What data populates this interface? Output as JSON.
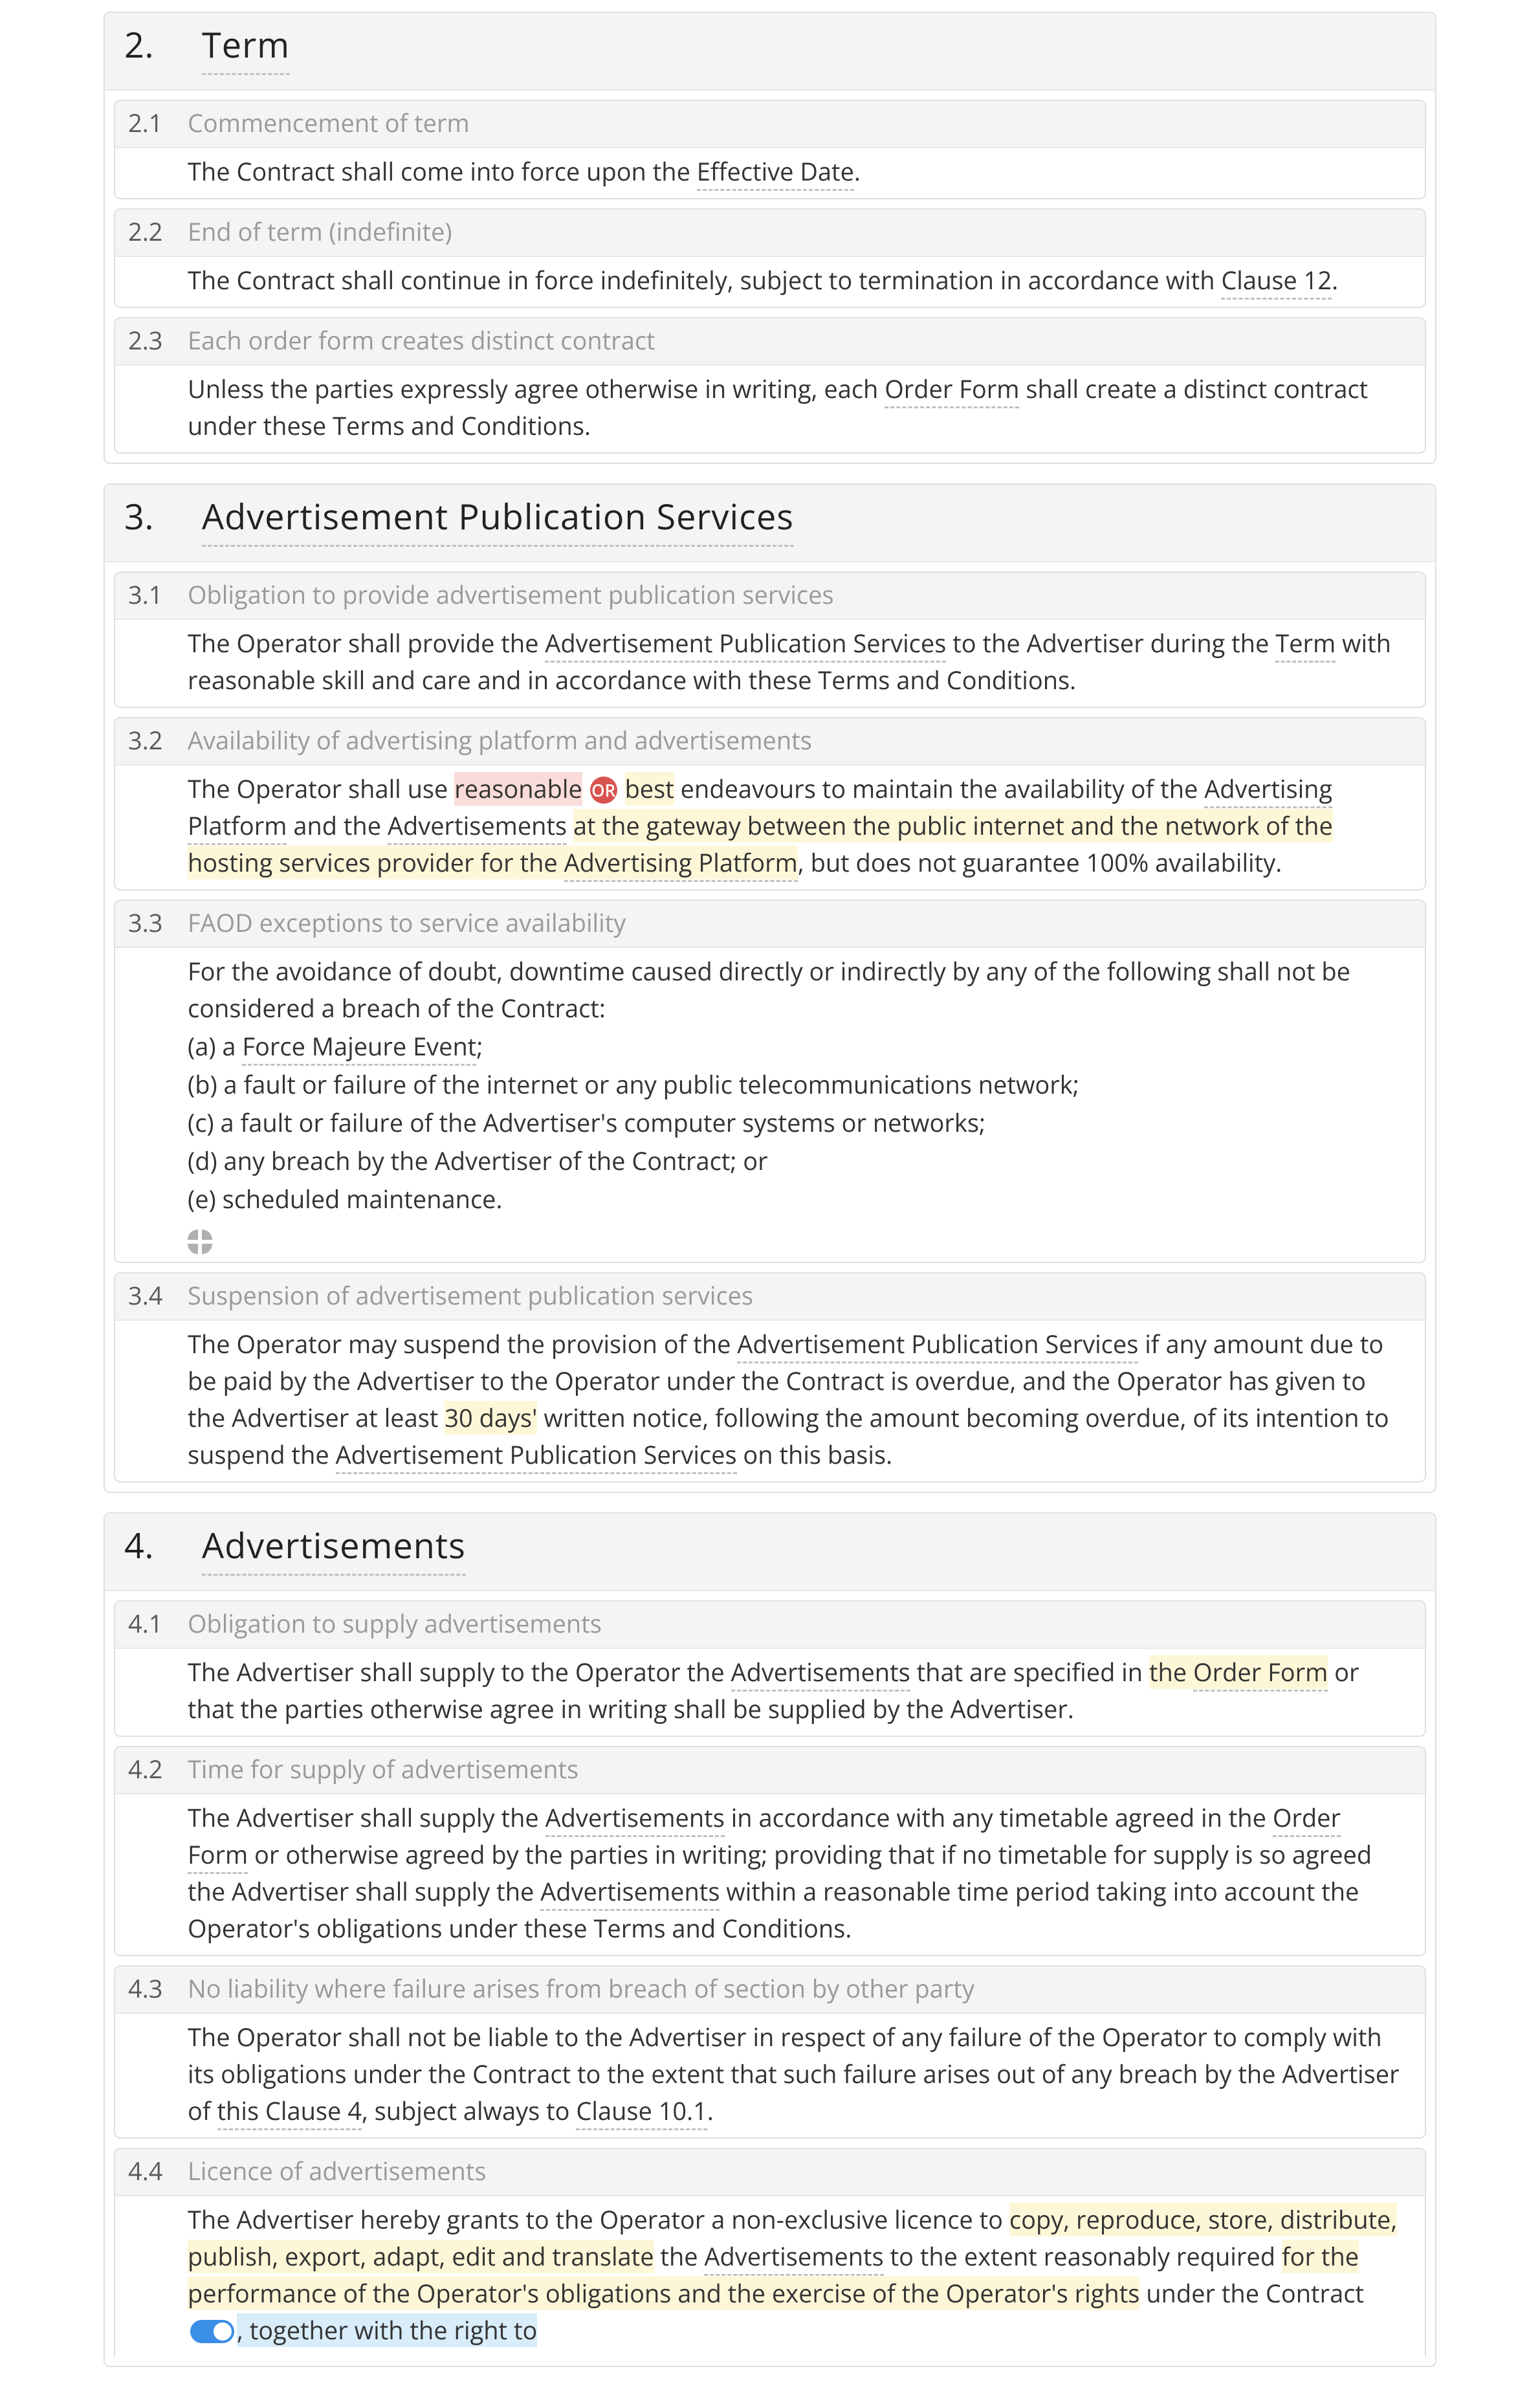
{
  "s2": {
    "num": "2.",
    "title": "Term",
    "c1": {
      "num": "2.1",
      "title": "Commencement of term",
      "t1": "The Contract shall come into force upon the ",
      "term1": "Effective Date",
      "t2": "."
    },
    "c2": {
      "num": "2.2",
      "title": "End of term (indefinite)",
      "t1": "The Contract shall continue in force indefinitely, subject to termination in accordance with ",
      "term1": "Clause 12",
      "t2": "."
    },
    "c3": {
      "num": "2.3",
      "title": "Each order form creates distinct contract",
      "t1": "Unless the parties expressly agree otherwise in writing, each ",
      "term1": "Order Form",
      "t2": " shall create a distinct contract under these Terms and Conditions."
    }
  },
  "s3": {
    "num": "3.",
    "title": "Advertisement Publication Services",
    "c1": {
      "num": "3.1",
      "title": "Obligation to provide advertisement publication services",
      "t1": "The Operator shall provide the ",
      "term1": "Advertisement Publication Services",
      "t2": " to the Advertiser during the ",
      "term2": "Term",
      "t3": " with reasonable skill and care and in accordance with these Terms and Conditions."
    },
    "c2": {
      "num": "3.2",
      "title": "Availability of advertising platform and advertisements",
      "t1": "The Operator shall use ",
      "opt1": "reasonable",
      "or": "OR",
      "opt2": "best",
      "t2": " endeavours to maintain the availability of the ",
      "term1": "Advertising Platform",
      "t3": " and the ",
      "term2": "Advertisements",
      "t4": " ",
      "hl1a": "at the gateway between the public internet and the network of the hosting services provider for the ",
      "hl1b": "Advertising Platform",
      "t5": ", but does not guarantee 100% availability."
    },
    "c3": {
      "num": "3.3",
      "title": "FAOD exceptions to service availability",
      "intro": "For the avoidance of doubt, downtime caused directly or indirectly by any of the following shall not be considered a breach of the Contract:",
      "a_pre": "(a)  a ",
      "a_term": "Force Majeure Event",
      "a_post": ";",
      "b": "(b)  a fault or failure of the internet or any public telecommunications network;",
      "c": "(c)  a fault or failure of the Advertiser's computer systems or networks;",
      "d": "(d)  any breach by the Advertiser of the Contract; or",
      "e": "(e)  scheduled maintenance."
    },
    "c4": {
      "num": "3.4",
      "title": "Suspension of advertisement publication services",
      "t1": "The Operator may suspend the provision of the ",
      "term1": "Advertisement Publication Services",
      "t2": " if any amount due to be paid by the Advertiser to the Operator under the Contract is overdue, and the Operator has given to the Advertiser at least ",
      "hl1": "30 days'",
      "t3": " written notice, following the amount becoming overdue, of its intention to suspend the ",
      "term2": "Advertisement Publication Services",
      "t4": " on this basis."
    }
  },
  "s4": {
    "num": "4.",
    "title": "Advertisements",
    "c1": {
      "num": "4.1",
      "title": "Obligation to supply advertisements",
      "t1": "The Advertiser shall supply to the Operator the ",
      "term1": "Advertisements",
      "t2": " that are specified in ",
      "hl1a": "the ",
      "hl1b": "Order Form",
      "t3": " or that the parties otherwise agree in writing shall be supplied by the Advertiser."
    },
    "c2": {
      "num": "4.2",
      "title": "Time for supply of advertisements",
      "t1": "The Advertiser shall supply the ",
      "term1": "Advertisements",
      "t2": " in accordance with any timetable agreed in the ",
      "term2": "Order Form",
      "t3": " or otherwise agreed by the parties in writing; providing that if no timetable for supply is so agreed the Advertiser shall supply the ",
      "term3": "Advertisements",
      "t4": " within a reasonable time period taking into account the Operator's obligations under these Terms and Conditions."
    },
    "c3": {
      "num": "4.3",
      "title": "No liability where failure arises from breach of section by other party",
      "t1": "The Operator shall not be liable to the Advertiser in respect of any failure of the Operator to comply with its obligations under the Contract to the extent that such failure arises out of any breach by the Advertiser of ",
      "term1": "this Clause 4",
      "t2": ", subject always to ",
      "term2": "Clause 10.1",
      "t3": "."
    },
    "c4": {
      "num": "4.4",
      "title": "Licence of advertisements",
      "t1": "The Advertiser hereby grants to the Operator a non-exclusive licence to ",
      "hl1": "copy, reproduce, store, distribute, publish, export, adapt, edit and translate",
      "t2": " the ",
      "term1": "Advertisements",
      "t3": " to the extent reasonably required ",
      "hl2": "for the performance of the Operator's obligations and the exercise of the Operator's rights",
      "t4": " under the Contract",
      "hl3": ", together with the right to"
    }
  }
}
